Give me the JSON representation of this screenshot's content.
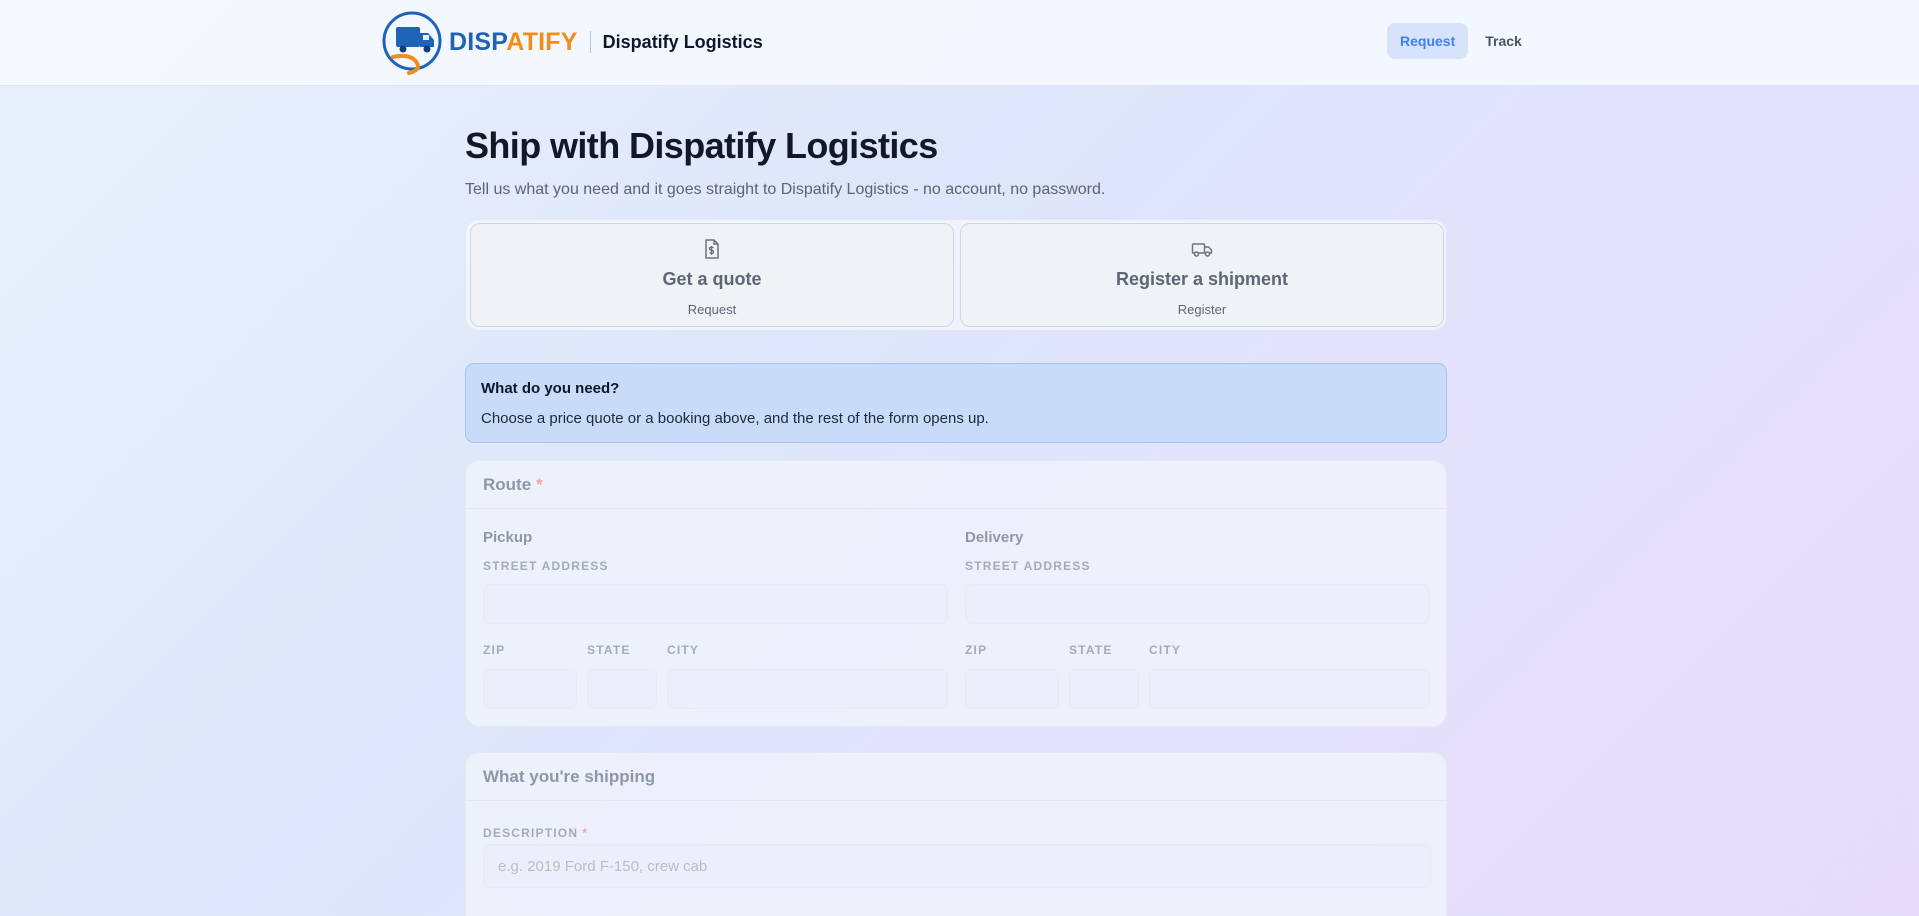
{
  "header": {
    "logo_part1": "DISP",
    "logo_part2": "ATIFY",
    "brand_name": "Dispatify Logistics",
    "nav": [
      {
        "label": "Request",
        "active": true
      },
      {
        "label": "Track",
        "active": false
      }
    ]
  },
  "page": {
    "title": "Ship with Dispatify Logistics",
    "subtitle": "Tell us what you need and it goes straight to Dispatify Logistics - no account, no password."
  },
  "choices": [
    {
      "title": "Get a quote",
      "sub": "Request",
      "icon": "document-dollar-icon"
    },
    {
      "title": "Register a shipment",
      "sub": "Register",
      "icon": "truck-icon"
    }
  ],
  "notice": {
    "heading": "What do you need?",
    "text": "Choose a price quote or a booking above, and the rest of the form opens up."
  },
  "route": {
    "title": "Route",
    "required_mark": "*",
    "pickup": {
      "title": "Pickup",
      "street_label": "Street address",
      "zip_label": "Zip",
      "state_label": "State",
      "city_label": "City"
    },
    "delivery": {
      "title": "Delivery",
      "street_label": "Street address",
      "zip_label": "Zip",
      "state_label": "State",
      "city_label": "City"
    }
  },
  "shipping": {
    "title": "What you're shipping",
    "description_label": "Description",
    "required_mark": "*",
    "description_placeholder": "e.g. 2019 Ford F-150, crew cab"
  },
  "colors": {
    "brand_blue": "#1f63b9",
    "brand_orange": "#f28c1d",
    "accent": "#3b82f6",
    "notice_bg": "#c8dbf9"
  }
}
